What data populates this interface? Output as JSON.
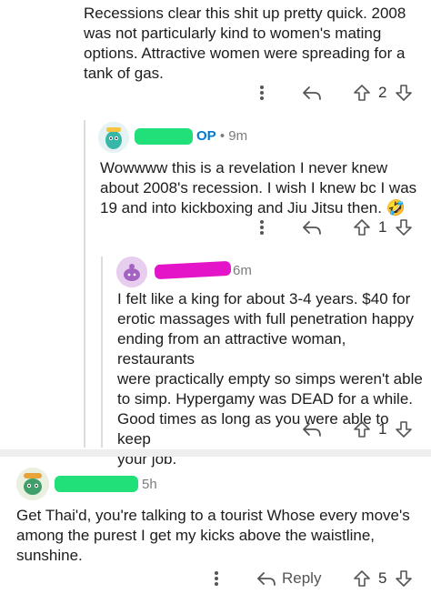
{
  "comments": [
    {
      "id": "c1",
      "body": "Recessions clear this shit up pretty quick. 2008\nwas not particularly kind to women's mating\noptions. Attractive women were spreading for a\ntank of gas.",
      "votes": "2"
    },
    {
      "id": "c2",
      "op_label": "OP",
      "time": "• 9m",
      "body": "Wowwww this is a revelation I never knew\nabout 2008's recession. I wish I knew bc I was\n19 and into kickboxing and Jiu Jitsu then. 🤣",
      "votes": "1"
    },
    {
      "id": "c3",
      "time": "6m",
      "body": "I felt like a king for about 3-4 years. $40 for\nerotic massages with full penetration happy\nending from an attractive woman, restaurants\nwere practically empty so simps weren't able\nto simp. Hypergamy was DEAD for a while.\nGood times as long as you were able to keep\nyour job.",
      "votes": "1"
    },
    {
      "id": "c4",
      "time": "5h",
      "body": "Get Thai'd, you're talking to a tourist Whose every move's\namong the purest I get my kicks above the waistline,\nsunshine.",
      "reply_label": "Reply",
      "votes": "5"
    }
  ],
  "icons": {
    "more": "more-vertical-icon",
    "reply": "reply-arrow-icon",
    "upvote": "upvote-arrow-icon",
    "downvote": "downvote-arrow-icon"
  },
  "colors": {
    "op": "#0079d3",
    "redact_green": "#21e07a",
    "redact_pink": "#e414c9",
    "thread_line": "#dcdcdc"
  }
}
